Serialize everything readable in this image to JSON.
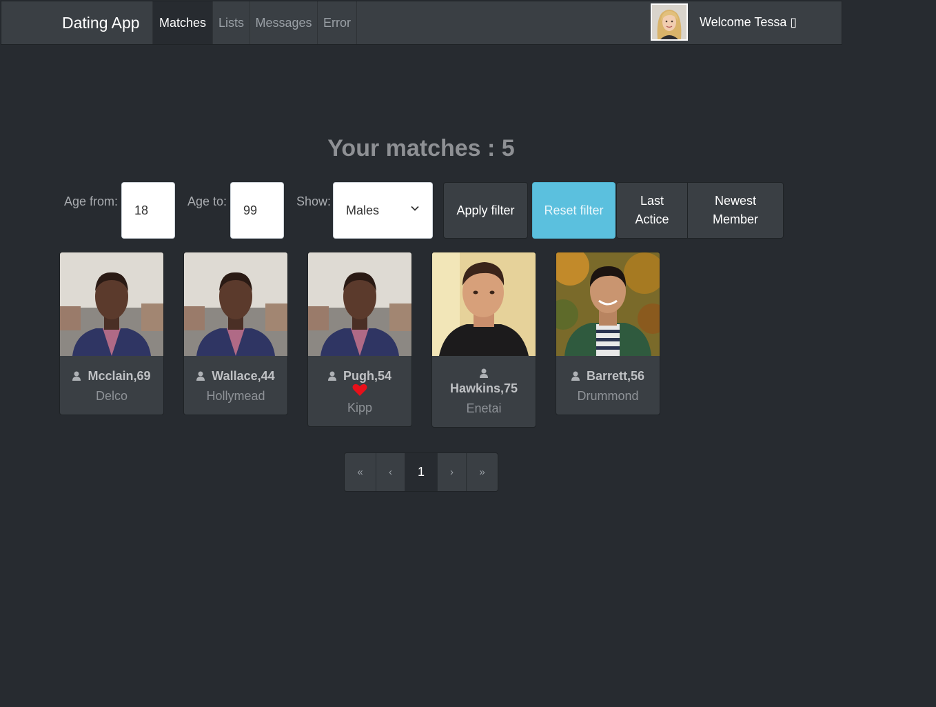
{
  "navbar": {
    "brand": "Dating App",
    "items": [
      {
        "label": "Matches",
        "active": true
      },
      {
        "label": "Lists",
        "active": false
      },
      {
        "label": "Messages",
        "active": false
      },
      {
        "label": "Error",
        "active": false
      }
    ],
    "welcome": "Welcome Tessa ▯"
  },
  "heading": "Your matches : 5",
  "filters": {
    "age_from_label": "Age from:",
    "age_from_value": "18",
    "age_to_label": "Age to:",
    "age_to_value": "99",
    "show_label": "Show:",
    "show_value": "Males",
    "apply_label": "Apply filter",
    "reset_label": "Reset filter",
    "last_active_label": "Last Actice",
    "newest_member_label": "Newest Member"
  },
  "members": [
    {
      "name": "Mcclain,69",
      "city": "Delco",
      "liked": false,
      "photo": "man-suit"
    },
    {
      "name": "Wallace,44",
      "city": "Hollymead",
      "liked": false,
      "photo": "man-suit"
    },
    {
      "name": "Pugh,54",
      "city": "Kipp",
      "liked": true,
      "photo": "man-suit"
    },
    {
      "name": "Hawkins,75",
      "city": "Enetai",
      "liked": false,
      "photo": "man-tshirt"
    },
    {
      "name": "Barrett,56",
      "city": "Drummond",
      "liked": false,
      "photo": "man-jacket"
    }
  ],
  "pagination": {
    "first": "«",
    "prev": "‹",
    "current": "1",
    "next": "›",
    "last": "»"
  },
  "colors": {
    "background": "#272b30",
    "navbar": "#3a3f44",
    "info_button": "#5bc0de",
    "heart": "#e8101a"
  }
}
